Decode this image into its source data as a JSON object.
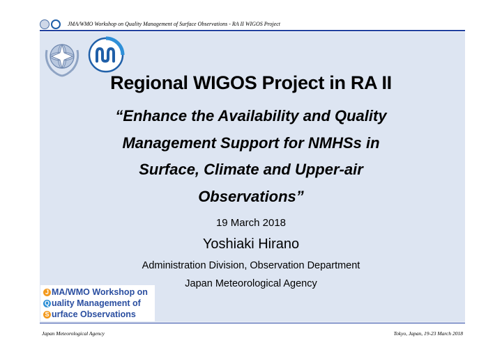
{
  "header": {
    "text": "JMA/WMO Workshop on Quality Management of Surface Observations - RA II WIGOS Project"
  },
  "slide": {
    "title": "Regional WIGOS Project in RA II",
    "subtitle_lines": [
      "“Enhance the Availability and Quality",
      "Management Support for NMHSs in",
      "Surface, Climate and Upper-air",
      "Observations”"
    ],
    "date": "19 March 2018",
    "author": "Yoshiaki Hirano",
    "affiliation_1": "Administration Division, Observation Department",
    "affiliation_2": "Japan Meteorological Agency"
  },
  "workshop_logo": {
    "lines": [
      {
        "cap": "J",
        "rest": "MA/WMO Workshop on"
      },
      {
        "cap": "Q",
        "rest": "uality Management of"
      },
      {
        "cap": "S",
        "rest": "urface Observations"
      }
    ]
  },
  "footer": {
    "left": "Japan Meteorological Agency",
    "right": "Tokyo, Japan, 19-23 March  2018"
  },
  "colors": {
    "panel": "#dde5f2",
    "rule": "#1f3f9f",
    "logo_blue": "#2a4ea0",
    "logo_orange": "#f39a1e"
  }
}
